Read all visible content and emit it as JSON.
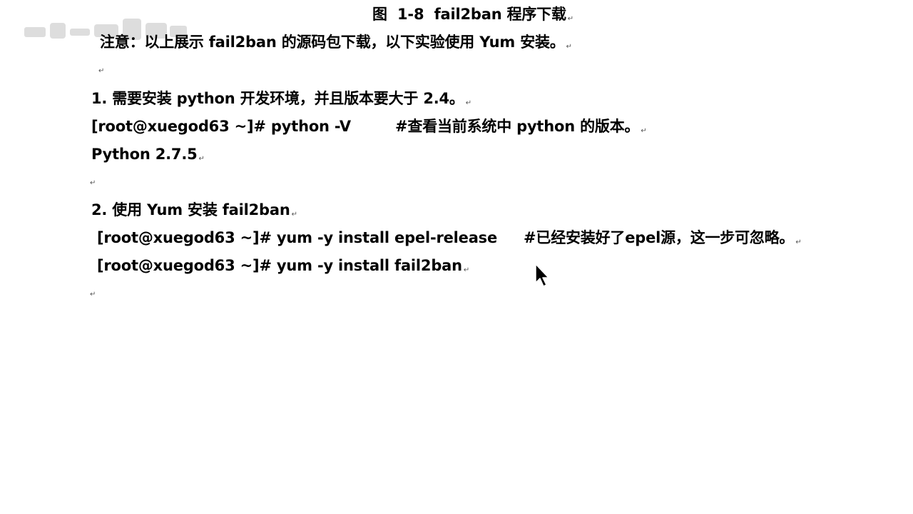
{
  "figure_caption": "图  1-8  fail2ban 程序下载",
  "note": "注意：以上展示 fail2ban 的源码包下载，以下实验使用 Yum 安装。",
  "step1": {
    "heading": "1. 需要安装 python 开发环境，并且版本要大于 2.4。",
    "command": "[root@xuegod63 ~]# python -V",
    "comment": "#查看当前系统中 python 的版本。",
    "output": "Python 2.7.5"
  },
  "step2": {
    "heading": "2. 使用 Yum 安装 fail2ban",
    "command1": "[root@xuegod63 ~]# yum -y install epel-release",
    "comment1": "#已经安装好了epel源，这一步可忽略。",
    "command2": "[root@xuegod63 ~]# yum -y install fail2ban"
  },
  "paragraph_mark": "↵",
  "colors": {
    "text": "#000000",
    "background": "#ffffff",
    "paragraph_mark": "#555555"
  },
  "icons": {
    "watermark": "blurred-logo-watermark",
    "cursor": "mouse-pointer-icon"
  }
}
